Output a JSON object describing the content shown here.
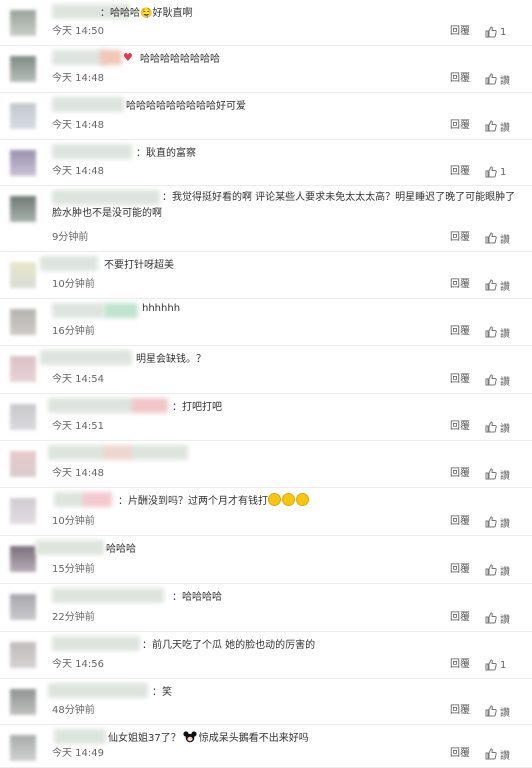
{
  "reply_label": "回覆",
  "like_label": "讚",
  "colors": {
    "background": "#ffffff",
    "divider": "#ececec",
    "text": "#333333",
    "meta": "#666666"
  },
  "comments": [
    {
      "text": "：哈哈哈🤤好耿直啊",
      "time": "今天 14:50",
      "likes": "1"
    },
    {
      "text": "哈哈哈哈哈哈哈哈",
      "time": "今天 14:48",
      "likes": ""
    },
    {
      "text": "哈哈哈哈哈哈哈哈哈好可爱",
      "time": "今天 14:48",
      "likes": ""
    },
    {
      "text": "：耿直的富察",
      "time": "今天 14:48",
      "likes": "1"
    },
    {
      "text": "：我觉得挺好看的啊 评论某些人要求未免太太太高？明星睡迟了晚了可能眼肿了脸水肿也不是没可能的啊",
      "time": "9分钟前",
      "likes": ""
    },
    {
      "text": "不要打针呀超美",
      "time": "10分钟前",
      "likes": ""
    },
    {
      "text": "hhhhhh",
      "time": "16分钟前",
      "likes": ""
    },
    {
      "text": "明星会缺钱。？",
      "time": "今天 14:54",
      "likes": ""
    },
    {
      "text": "：打吧打吧",
      "time": "今天 14:51",
      "likes": ""
    },
    {
      "text": "",
      "time": "今天 14:48",
      "likes": ""
    },
    {
      "text": "：片酬没到吗？过两个月才有钱打",
      "time": "10分钟前",
      "likes": ""
    },
    {
      "text": "哈哈哈",
      "time": "15分钟前",
      "likes": ""
    },
    {
      "text": "：哈哈哈哈",
      "time": "22分钟前",
      "likes": ""
    },
    {
      "text": "：前几天吃了个瓜 她的脸也动的厉害的",
      "time": "今天 14:56",
      "likes": "1"
    },
    {
      "text": "：笑",
      "time": "48分钟前",
      "likes": ""
    },
    {
      "text": "仙女姐姐37了？",
      "text2": "惊成呆头鵝看不出来好吗",
      "time": "今天 14:49",
      "likes": ""
    }
  ]
}
